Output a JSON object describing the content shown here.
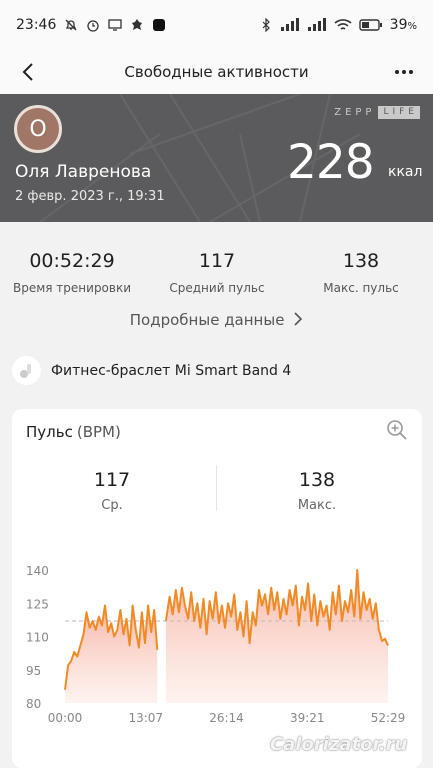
{
  "status_bar": {
    "time": "23:46",
    "battery": "39",
    "battery_unit": "%"
  },
  "nav": {
    "title": "Свободные активности"
  },
  "hero": {
    "avatar_letter": "О",
    "user_name": "Оля Лавренова",
    "date": "2 февр. 2023 г., 19:31",
    "calories": "228",
    "calories_unit": "ккал",
    "brand_text": "ZEPP",
    "brand_box": "LIFE"
  },
  "stats": [
    {
      "value": "00:52:29",
      "label": "Время тренировки"
    },
    {
      "value": "117",
      "label": "Средний пульс"
    },
    {
      "value": "138",
      "label": "Макс. пульс"
    }
  ],
  "details_link": "Подробные данные",
  "device": {
    "name": "Фитнес-браслет Mi Smart Band 4"
  },
  "heart_card": {
    "title": "Пульс",
    "unit": "(BPM)",
    "avg_value": "117",
    "avg_label": "Ср.",
    "max_value": "138",
    "max_label": "Макс."
  },
  "colors": {
    "accent": "#f08a24",
    "hero_bg": "#5b5b5d",
    "fill_top": "#f7b7a6"
  },
  "chart_data": {
    "type": "area",
    "x_tick_labels": [
      "00:00",
      "13:07",
      "26:14",
      "39:21",
      "52:29"
    ],
    "y_ticks": [
      80,
      95,
      110,
      125,
      140
    ],
    "ylim": [
      80,
      145
    ],
    "xlim_minutes": [
      0,
      52.48
    ],
    "average_line": 117,
    "gap_minutes": [
      15.0,
      16.4
    ],
    "series": [
      {
        "x": [
          0.0,
          0.5,
          1.0,
          1.5,
          2.0,
          2.5,
          3.0,
          3.5,
          4.0,
          4.5,
          5.0,
          5.5,
          6.0,
          6.5,
          7.0,
          7.5,
          8.0,
          8.5,
          9.0,
          9.5,
          10.0,
          10.5,
          11.0,
          11.5,
          12.0,
          12.5,
          13.0,
          13.5,
          14.0,
          14.5,
          15.0,
          16.4,
          17.0,
          17.5,
          18.0,
          18.5,
          19.0,
          19.5,
          20.0,
          20.5,
          21.0,
          21.5,
          22.0,
          22.5,
          23.0,
          23.5,
          24.0,
          24.5,
          25.0,
          25.5,
          26.0,
          26.5,
          27.0,
          27.5,
          28.0,
          28.5,
          29.0,
          29.5,
          30.0,
          30.5,
          31.0,
          31.5,
          32.0,
          32.5,
          33.0,
          33.5,
          34.0,
          34.5,
          35.0,
          35.5,
          36.0,
          36.5,
          37.0,
          37.5,
          38.0,
          38.5,
          39.0,
          39.5,
          40.0,
          40.5,
          41.0,
          41.5,
          42.0,
          42.5,
          43.0,
          43.5,
          44.0,
          44.5,
          45.0,
          45.5,
          46.0,
          46.5,
          47.0,
          47.5,
          48.0,
          48.5,
          49.0,
          49.5,
          50.0,
          50.5,
          51.0,
          51.5,
          52.0,
          52.48
        ],
        "y": [
          86,
          97,
          99,
          103,
          101,
          106,
          111,
          121,
          114,
          117,
          113,
          119,
          115,
          124,
          112,
          116,
          110,
          113,
          122,
          111,
          118,
          106,
          124,
          113,
          105,
          121,
          107,
          124,
          112,
          122,
          104,
          117,
          128,
          120,
          131,
          121,
          132,
          124,
          118,
          130,
          117,
          125,
          114,
          127,
          111,
          126,
          118,
          130,
          116,
          124,
          114,
          125,
          119,
          129,
          113,
          121,
          110,
          126,
          107,
          121,
          115,
          131,
          124,
          129,
          120,
          132,
          122,
          130,
          118,
          127,
          120,
          131,
          124,
          133,
          115,
          128,
          122,
          134,
          117,
          129,
          115,
          126,
          119,
          124,
          113,
          130,
          120,
          133,
          117,
          126,
          121,
          131,
          119,
          140,
          118,
          130,
          122,
          127,
          118,
          125,
          113,
          108,
          109,
          106
        ]
      }
    ]
  }
}
